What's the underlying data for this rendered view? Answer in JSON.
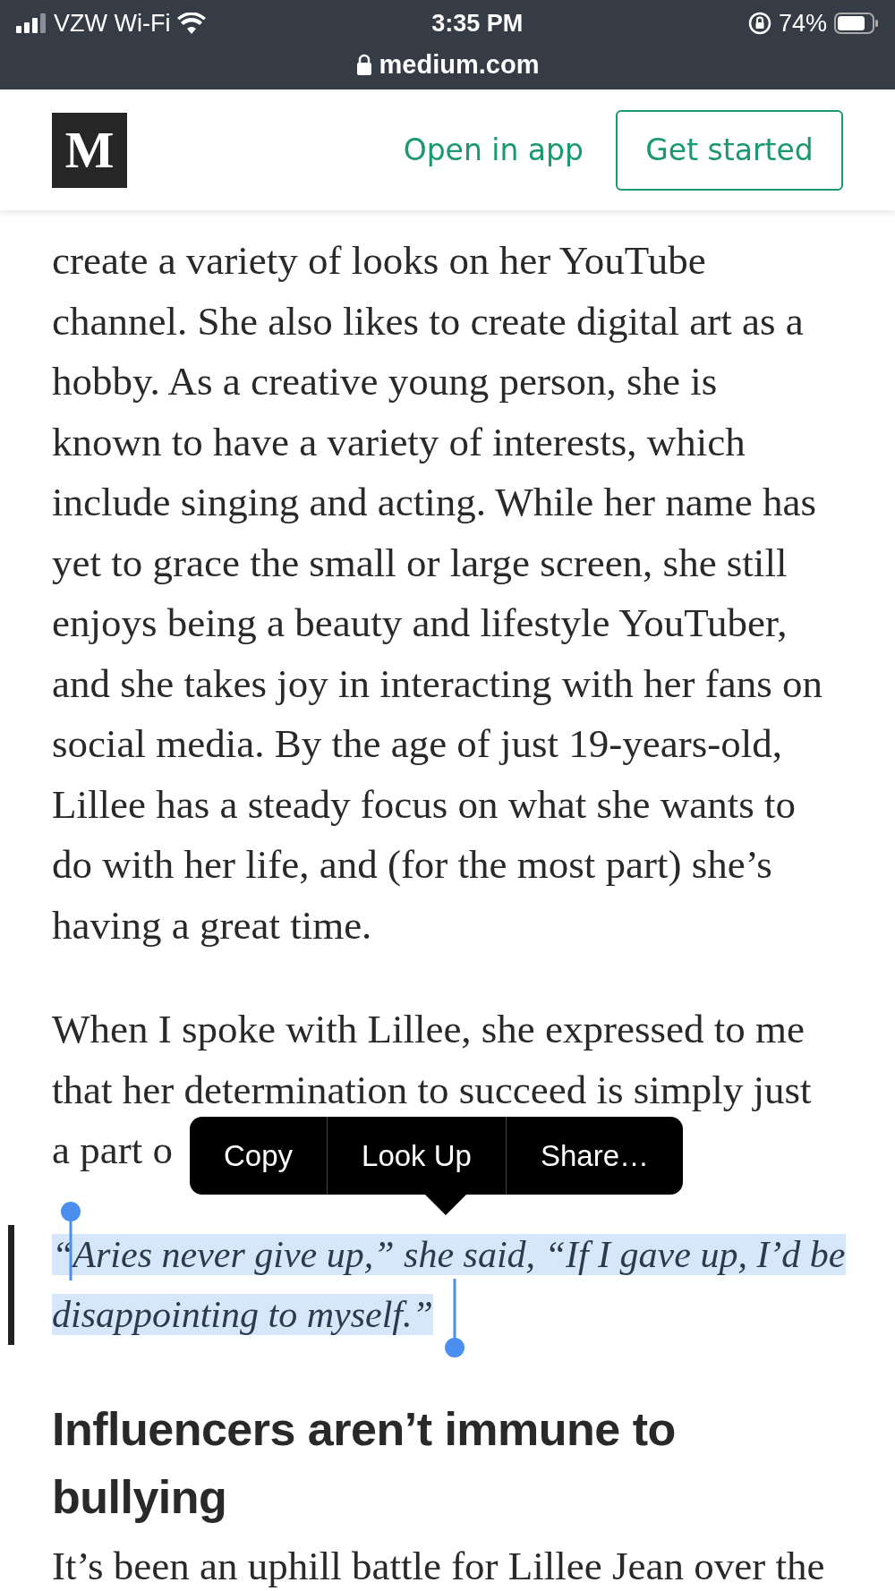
{
  "status_bar": {
    "carrier": "VZW Wi-Fi",
    "time": "3:35 PM",
    "battery": "74%",
    "address": "medium.com"
  },
  "header": {
    "logo": "M",
    "links": [
      {
        "label": "Open in app",
        "kind": "link"
      },
      {
        "label": "Get started",
        "kind": "outline"
      }
    ]
  },
  "article": [
    {
      "kind": "paragraph",
      "lines": [
        "create a variety of looks on her YouTube",
        "channel. She also likes to create digital art as a",
        "hobby. As a creative young person, she is",
        "known to have a variety of interests, which",
        "include singing and acting. While her name has",
        "yet to grace the small or large screen, she still",
        "enjoys being a beauty and lifestyle YouTuber,",
        "and she takes joy in interacting with her fans on",
        "social media. By the age of just 19-years-old,",
        "Lillee has a steady focus on what she wants to",
        "do with her life, and (for the most part) she’s",
        "having a great time."
      ]
    },
    {
      "kind": "paragraph",
      "lines": [
        "When I spoke with Lillee, she expressed to me",
        "that her determination to succeed is simply just",
        "a part o"
      ]
    },
    {
      "kind": "quote",
      "selected": true,
      "lines": [
        "“Aries never give up,” she said, “If I gave up, I’d be",
        "disappointing to myself.”"
      ]
    },
    {
      "kind": "heading",
      "lines": [
        "Influencers aren’t immune to",
        "bullying"
      ]
    },
    {
      "kind": "paragraph",
      "lines": [
        "It’s been an uphill battle for Lillee Jean over the"
      ]
    }
  ],
  "context_menu": {
    "items": [
      "Copy",
      "Look Up",
      "Share…"
    ]
  }
}
